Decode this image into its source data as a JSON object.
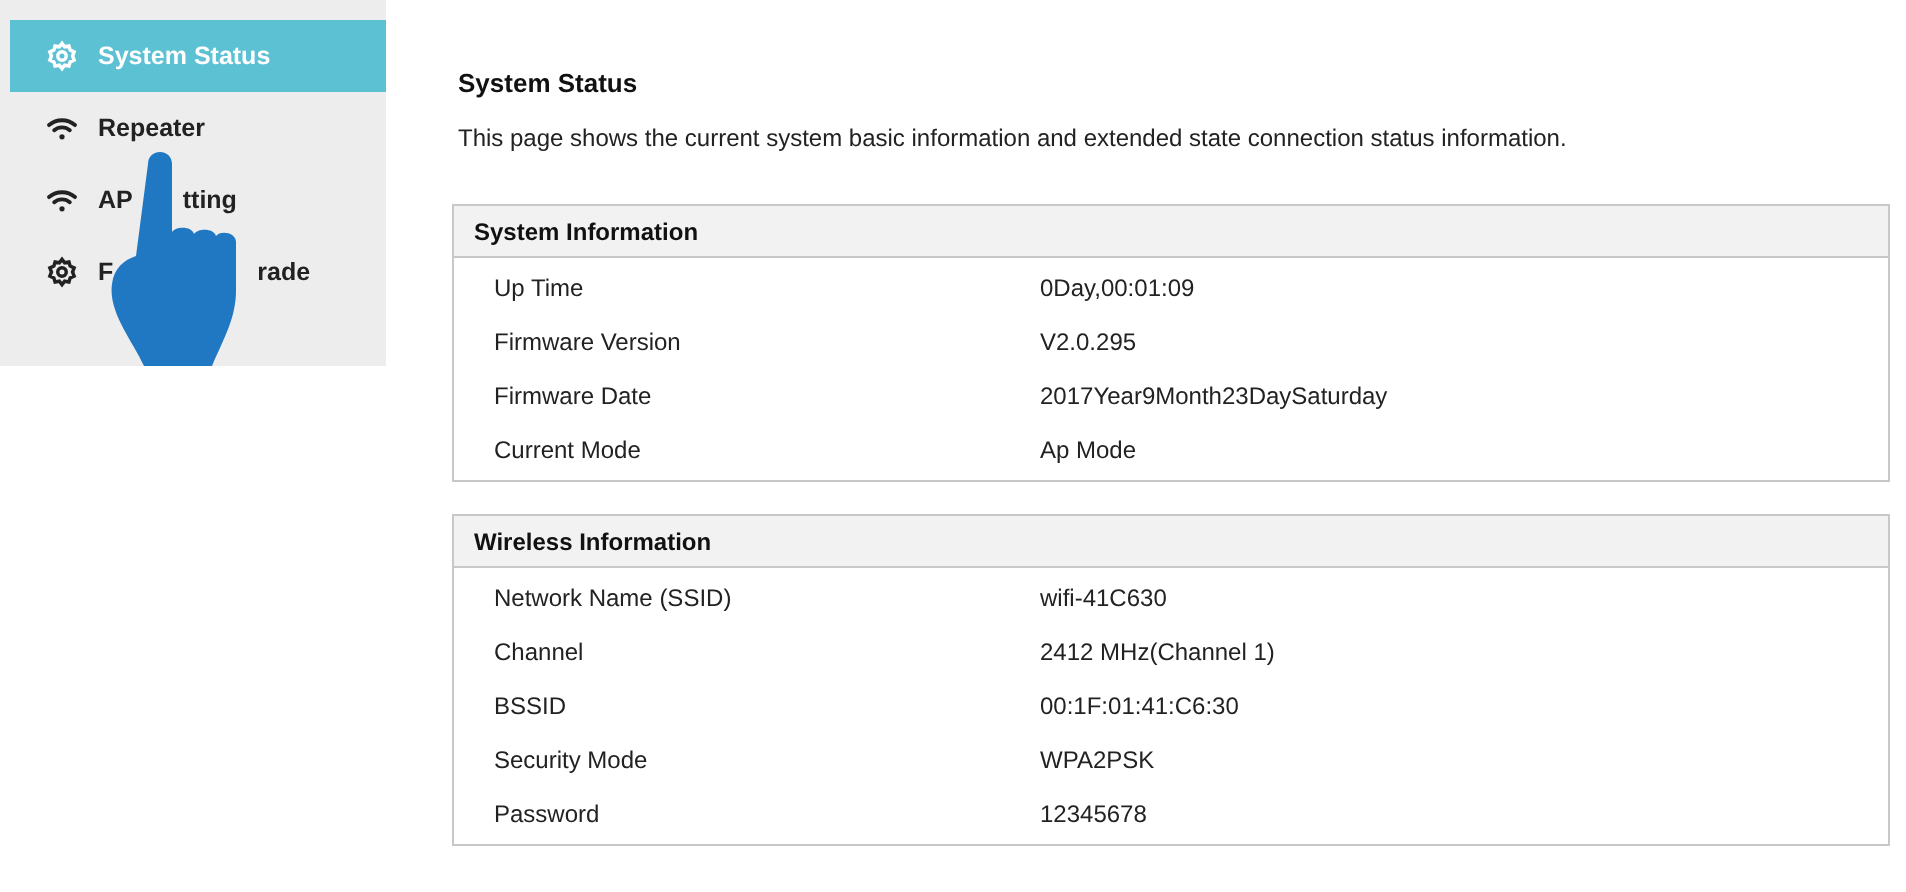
{
  "sidebar": {
    "items": [
      {
        "kind": "gear",
        "label_parts": [
          "System Status"
        ],
        "selected": true
      },
      {
        "kind": "wifi",
        "label_parts": [
          "Repeater"
        ],
        "selected": false
      },
      {
        "kind": "wifi",
        "label_parts": [
          "AP",
          "tting"
        ],
        "selected": false
      },
      {
        "kind": "gear",
        "label_parts": [
          "F",
          "rade"
        ],
        "selected": false
      }
    ]
  },
  "page": {
    "title": "System Status",
    "description": "This page shows the current system basic information and extended state connection status information."
  },
  "panels": [
    {
      "title": "System Information",
      "rows": [
        {
          "label": "Up Time",
          "value": "0Day,00:01:09"
        },
        {
          "label": "Firmware Version",
          "value": "V2.0.295"
        },
        {
          "label": "Firmware Date",
          "value": "2017Year9Month23DaySaturday"
        },
        {
          "label": "Current Mode",
          "value": "Ap Mode"
        }
      ]
    },
    {
      "title": "Wireless Information",
      "rows": [
        {
          "label": "Network Name (SSID)",
          "value": "wifi-41C630"
        },
        {
          "label": "Channel",
          "value": "2412 MHz(Channel 1)"
        },
        {
          "label": "BSSID",
          "value": "00:1F:01:41:C6:30"
        },
        {
          "label": "Security Mode",
          "value": "WPA2PSK"
        },
        {
          "label": "Password",
          "value": "12345678"
        }
      ]
    }
  ]
}
